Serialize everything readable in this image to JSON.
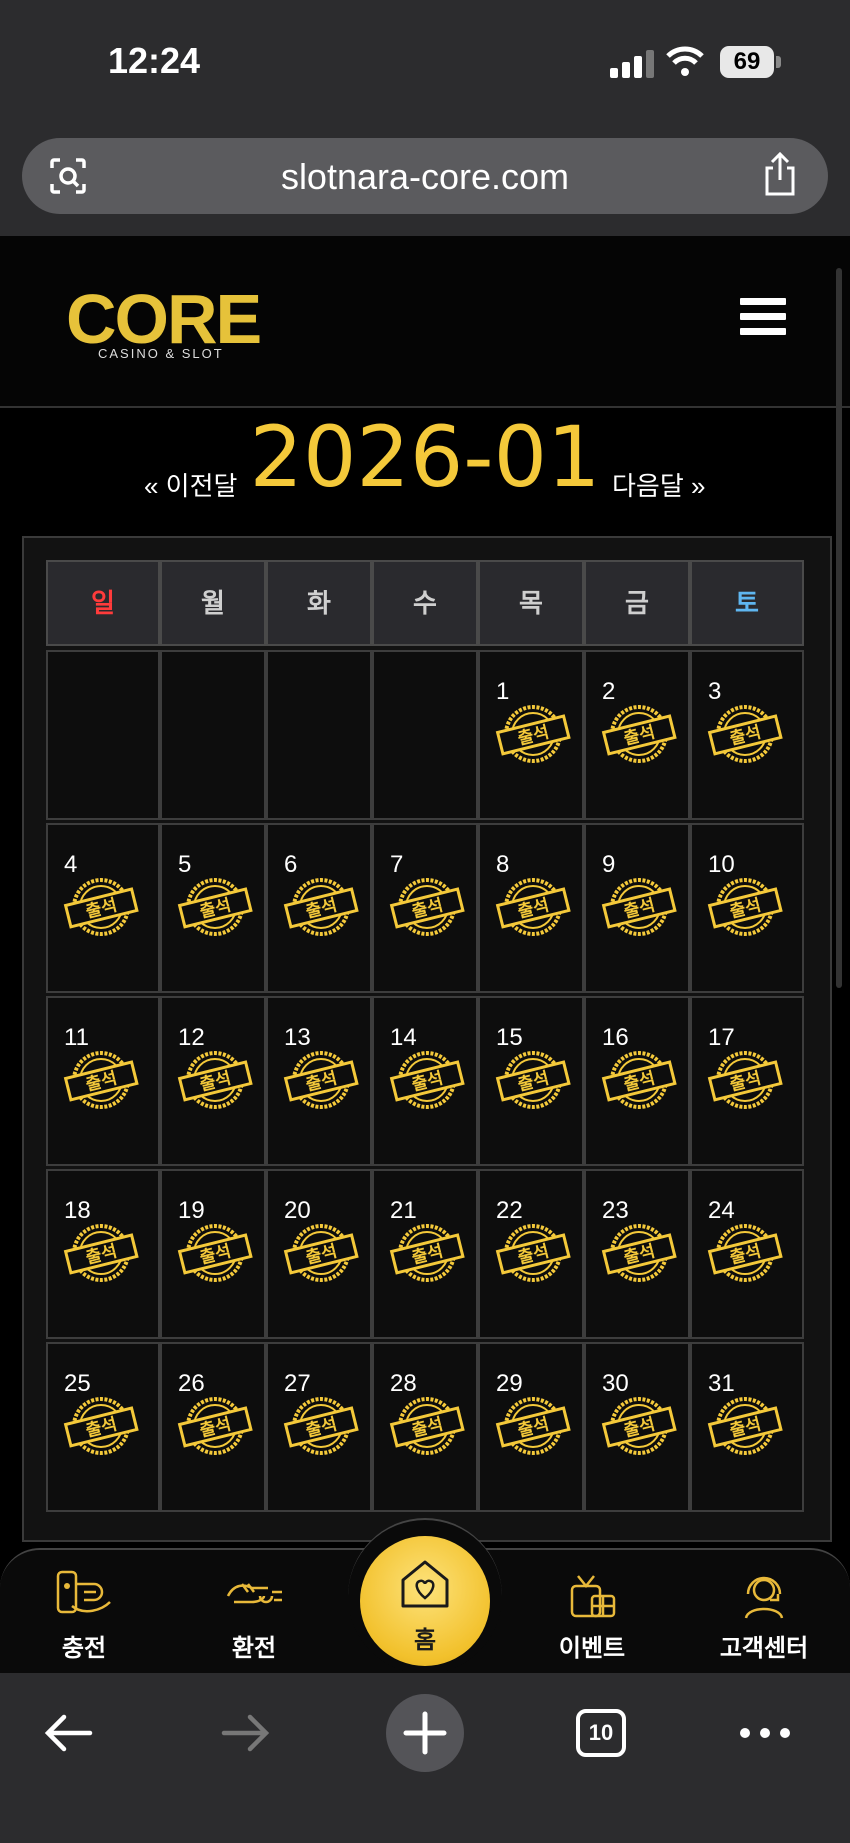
{
  "status": {
    "time": "12:24",
    "battery": "69"
  },
  "browser_url": "slotnara-core.com",
  "logo": {
    "main": "CORE",
    "sub": "CASINO & SLOT"
  },
  "month_nav": {
    "prev": "« 이전달",
    "title": "2026-01",
    "next": "다음달 »"
  },
  "weekdays": [
    "일",
    "월",
    "화",
    "수",
    "목",
    "금",
    "토"
  ],
  "weekday_colors": {
    "sun": "#ff3b3b",
    "sat": "#5fb6f0",
    "default": "#cfcfcf"
  },
  "stamp_label": "출석",
  "calendar": {
    "first_weekday": 4,
    "days": [
      "1",
      "2",
      "3",
      "4",
      "5",
      "6",
      "7",
      "8",
      "9",
      "10",
      "11",
      "12",
      "13",
      "14",
      "15",
      "16",
      "17",
      "18",
      "19",
      "20",
      "21",
      "22",
      "23",
      "24",
      "25",
      "26",
      "27",
      "28",
      "29",
      "30",
      "31"
    ]
  },
  "bottom_nav": {
    "charge": "충전",
    "exchange": "환전",
    "home": "홈",
    "event": "이벤트",
    "support": "고객센터"
  },
  "browser_toolbar": {
    "tabs_count": "10"
  },
  "colors": {
    "gold": "#f4c93a",
    "background": "#000000"
  }
}
